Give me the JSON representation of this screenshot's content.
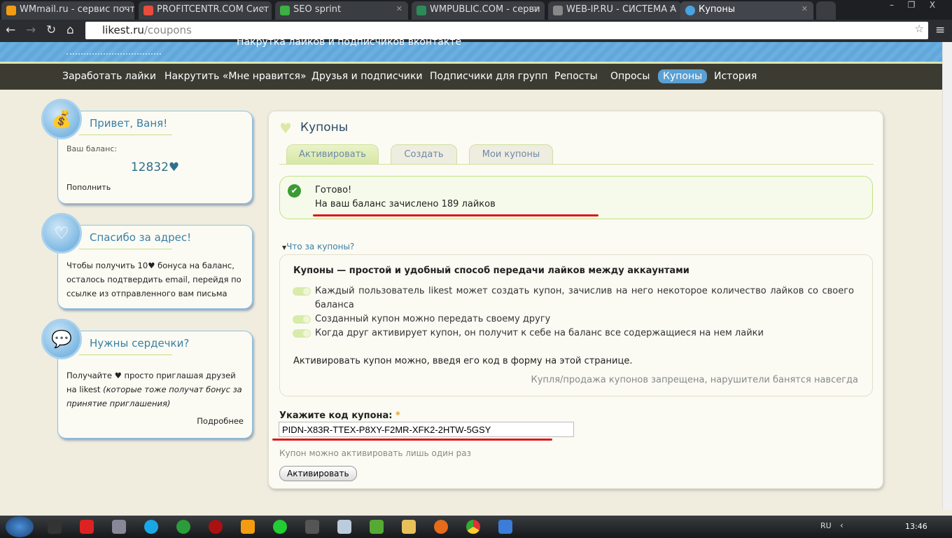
{
  "browser": {
    "tabs": [
      {
        "label": "WMmail.ru - сервис почт",
        "color": "#f39c12"
      },
      {
        "label": "PROFITCENTR.COM Сист",
        "color": "#e74c3c"
      },
      {
        "label": "SEO sprint",
        "color": "#3cb043"
      },
      {
        "label": "WMPUBLIC.COM - серви",
        "color": "#2e8b57"
      },
      {
        "label": "WEB-IP.RU - СИСТЕМА А",
        "color": "#888888"
      },
      {
        "label": "Купоны",
        "color": "#4aa3df"
      }
    ],
    "url_host": "likest.ru",
    "url_path": "/coupons"
  },
  "header": {
    "slogan": "Накрутка лайков и подписчиков вконтакте"
  },
  "menu": [
    "Заработать лайки",
    "Накрутить «Мне нравится»",
    "Друзья и подписчики",
    "Подписчики для групп",
    "Репосты",
    "Опросы",
    "Купоны",
    "История"
  ],
  "sidebar": {
    "greeting": {
      "title": "Привет, Ваня!",
      "balance_label": "Ваш баланс:",
      "balance": "12832♥",
      "topup": "Пополнить"
    },
    "email": {
      "title": "Спасибо за адрес!",
      "text": "Чтобы получить 10♥ бонуса на баланс, осталось подтвердить email, перейдя по ссылке из отправленного вам письма"
    },
    "invite": {
      "title": "Нужны сердечки?",
      "text": "Получайте ♥ просто приглашая друзей на likest",
      "text_italic": "(которые тоже получат бонус за принятие приглашения)",
      "more": "Подробнее"
    }
  },
  "main": {
    "title": "Купоны",
    "tabs": [
      "Активировать",
      "Создать",
      "Мои купоны"
    ],
    "message": {
      "title": "Готово!",
      "text": "На ваш баланс зачислено 189 лайков"
    },
    "faq_toggle": "Что за купоны?",
    "faq": {
      "heading": "Купоны — простой и удобный способ передачи лайков между аккаунтами",
      "items": [
        "Каждый пользователь likest может создать купон, зачислив на него некоторое количество лайков со своего баланса",
        "Созданный купон можно передать своему другу",
        "Когда друг активирует купон, он получит к себе на баланс все содержащиеся на нем лайки"
      ],
      "note": "Активировать купон можно, введя его код в форму на этой странице.",
      "warning": "Купля/продажа купонов запрещена, нарушители банятся навсегда"
    },
    "form": {
      "label": "Укажите код купона:",
      "required": "*",
      "value": "PIDN-X83R-TTEX-P8XY-F2MR-XFK2-2HTW-5GSY",
      "hint": "Купон можно активировать лишь один раз",
      "submit": "Активировать"
    }
  },
  "taskbar": {
    "lang": "RU",
    "time": "13:46"
  }
}
